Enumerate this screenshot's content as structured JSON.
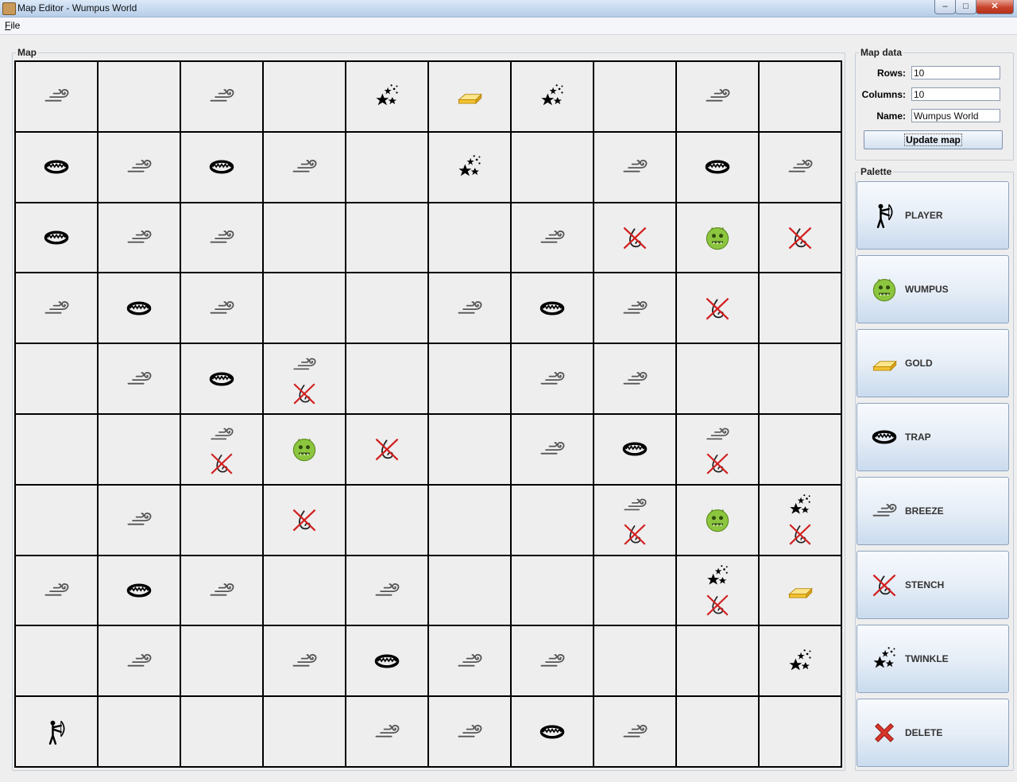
{
  "window": {
    "title": "Map Editor - Wumpus World",
    "min": "–",
    "max": "□",
    "close": "✕"
  },
  "menu": {
    "file_underline": "F",
    "file_rest": "ile"
  },
  "map": {
    "label": "Map",
    "rows": [
      [
        [
          "breeze"
        ],
        [],
        [
          "breeze"
        ],
        [],
        [
          "twinkle"
        ],
        [
          "gold"
        ],
        [
          "twinkle"
        ],
        [],
        [
          "breeze"
        ],
        []
      ],
      [
        [
          "trap"
        ],
        [
          "breeze"
        ],
        [
          "trap"
        ],
        [
          "breeze"
        ],
        [],
        [
          "twinkle"
        ],
        [],
        [
          "breeze"
        ],
        [
          "trap"
        ],
        [
          "breeze"
        ]
      ],
      [
        [
          "trap"
        ],
        [
          "breeze"
        ],
        [
          "breeze"
        ],
        [],
        [],
        [],
        [
          "breeze"
        ],
        [
          "stench"
        ],
        [
          "wumpus"
        ],
        [
          "stench"
        ]
      ],
      [
        [
          "breeze"
        ],
        [
          "trap"
        ],
        [
          "breeze"
        ],
        [],
        [],
        [
          "breeze"
        ],
        [
          "trap"
        ],
        [
          "breeze"
        ],
        [
          "stench"
        ],
        []
      ],
      [
        [],
        [
          "breeze"
        ],
        [
          "trap"
        ],
        [
          "breeze",
          "stench"
        ],
        [],
        [],
        [
          "breeze"
        ],
        [
          "breeze"
        ],
        [],
        []
      ],
      [
        [],
        [],
        [
          "breeze",
          "stench"
        ],
        [
          "wumpus"
        ],
        [
          "stench"
        ],
        [],
        [
          "breeze"
        ],
        [
          "trap"
        ],
        [
          "breeze",
          "stench"
        ],
        []
      ],
      [
        [],
        [
          "breeze"
        ],
        [],
        [
          "stench"
        ],
        [],
        [],
        [],
        [
          "breeze",
          "stench"
        ],
        [
          "wumpus"
        ],
        [
          "twinkle",
          "stench"
        ]
      ],
      [
        [
          "breeze"
        ],
        [
          "trap"
        ],
        [
          "breeze"
        ],
        [],
        [
          "breeze"
        ],
        [],
        [],
        [],
        [
          "twinkle",
          "stench"
        ],
        [
          "gold"
        ]
      ],
      [
        [],
        [
          "breeze"
        ],
        [],
        [
          "breeze"
        ],
        [
          "trap"
        ],
        [
          "breeze"
        ],
        [
          "breeze"
        ],
        [],
        [],
        [
          "twinkle"
        ]
      ],
      [
        [
          "player"
        ],
        [],
        [],
        [],
        [
          "breeze"
        ],
        [
          "breeze"
        ],
        [
          "trap"
        ],
        [
          "breeze"
        ],
        [],
        []
      ]
    ]
  },
  "map_data": {
    "label": "Map data",
    "rows_label": "Rows:",
    "rows_value": "10",
    "columns_label": "Columns:",
    "columns_value": "10",
    "name_label": "Name:",
    "name_value": "Wumpus World",
    "update_button": "Update map"
  },
  "palette": {
    "label": "Palette",
    "items": [
      {
        "id": "player",
        "label": "PLAYER"
      },
      {
        "id": "wumpus",
        "label": "WUMPUS"
      },
      {
        "id": "gold",
        "label": "GOLD"
      },
      {
        "id": "trap",
        "label": "TRAP"
      },
      {
        "id": "breeze",
        "label": "BREEZE"
      },
      {
        "id": "stench",
        "label": "STENCH"
      },
      {
        "id": "twinkle",
        "label": "TWINKLE"
      },
      {
        "id": "delete",
        "label": "DELETE"
      }
    ]
  },
  "colors": {
    "wumpus": "#8cc63f",
    "gold": "#f2c230",
    "stench_cross": "#d21f1f",
    "delete": "#d8352a"
  }
}
